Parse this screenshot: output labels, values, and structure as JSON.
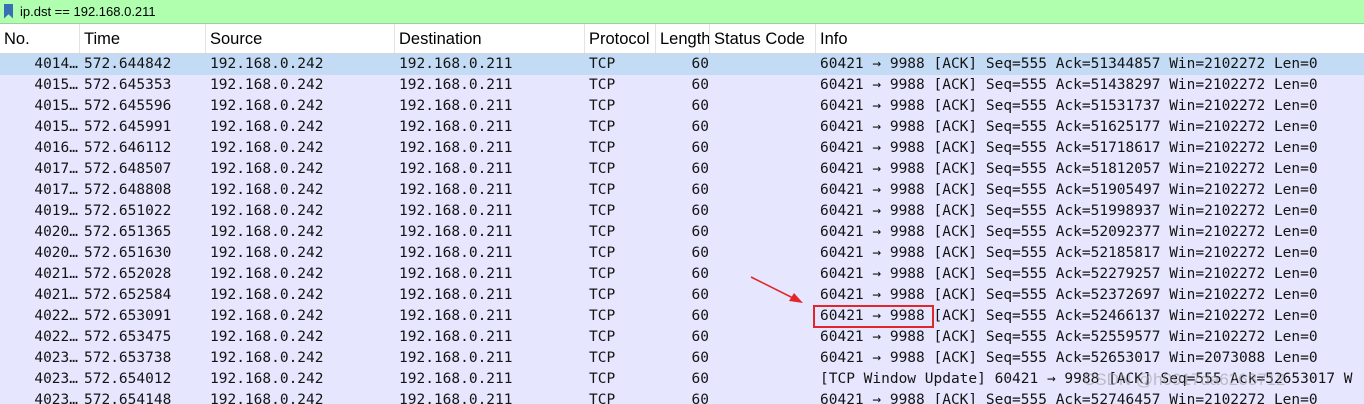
{
  "filter": {
    "value": "ip.dst == 192.168.0.211"
  },
  "columns": {
    "no": "No.",
    "time": "Time",
    "source": "Source",
    "destination": "Destination",
    "protocol": "Protocol",
    "length": "Length",
    "status": "Status Code",
    "info": "Info"
  },
  "packets": [
    {
      "no": "4014…",
      "time": "572.644842",
      "src": "192.168.0.242",
      "dst": "192.168.0.211",
      "proto": "TCP",
      "len": "60",
      "status": "",
      "info": "60421 → 9988 [ACK] Seq=555 Ack=51344857 Win=2102272 Len=0"
    },
    {
      "no": "4015…",
      "time": "572.645353",
      "src": "192.168.0.242",
      "dst": "192.168.0.211",
      "proto": "TCP",
      "len": "60",
      "status": "",
      "info": "60421 → 9988 [ACK] Seq=555 Ack=51438297 Win=2102272 Len=0"
    },
    {
      "no": "4015…",
      "time": "572.645596",
      "src": "192.168.0.242",
      "dst": "192.168.0.211",
      "proto": "TCP",
      "len": "60",
      "status": "",
      "info": "60421 → 9988 [ACK] Seq=555 Ack=51531737 Win=2102272 Len=0"
    },
    {
      "no": "4015…",
      "time": "572.645991",
      "src": "192.168.0.242",
      "dst": "192.168.0.211",
      "proto": "TCP",
      "len": "60",
      "status": "",
      "info": "60421 → 9988 [ACK] Seq=555 Ack=51625177 Win=2102272 Len=0"
    },
    {
      "no": "4016…",
      "time": "572.646112",
      "src": "192.168.0.242",
      "dst": "192.168.0.211",
      "proto": "TCP",
      "len": "60",
      "status": "",
      "info": "60421 → 9988 [ACK] Seq=555 Ack=51718617 Win=2102272 Len=0"
    },
    {
      "no": "4017…",
      "time": "572.648507",
      "src": "192.168.0.242",
      "dst": "192.168.0.211",
      "proto": "TCP",
      "len": "60",
      "status": "",
      "info": "60421 → 9988 [ACK] Seq=555 Ack=51812057 Win=2102272 Len=0"
    },
    {
      "no": "4017…",
      "time": "572.648808",
      "src": "192.168.0.242",
      "dst": "192.168.0.211",
      "proto": "TCP",
      "len": "60",
      "status": "",
      "info": "60421 → 9988 [ACK] Seq=555 Ack=51905497 Win=2102272 Len=0"
    },
    {
      "no": "4019…",
      "time": "572.651022",
      "src": "192.168.0.242",
      "dst": "192.168.0.211",
      "proto": "TCP",
      "len": "60",
      "status": "",
      "info": "60421 → 9988 [ACK] Seq=555 Ack=51998937 Win=2102272 Len=0"
    },
    {
      "no": "4020…",
      "time": "572.651365",
      "src": "192.168.0.242",
      "dst": "192.168.0.211",
      "proto": "TCP",
      "len": "60",
      "status": "",
      "info": "60421 → 9988 [ACK] Seq=555 Ack=52092377 Win=2102272 Len=0"
    },
    {
      "no": "4020…",
      "time": "572.651630",
      "src": "192.168.0.242",
      "dst": "192.168.0.211",
      "proto": "TCP",
      "len": "60",
      "status": "",
      "info": "60421 → 9988 [ACK] Seq=555 Ack=52185817 Win=2102272 Len=0"
    },
    {
      "no": "4021…",
      "time": "572.652028",
      "src": "192.168.0.242",
      "dst": "192.168.0.211",
      "proto": "TCP",
      "len": "60",
      "status": "",
      "info": "60421 → 9988 [ACK] Seq=555 Ack=52279257 Win=2102272 Len=0"
    },
    {
      "no": "4021…",
      "time": "572.652584",
      "src": "192.168.0.242",
      "dst": "192.168.0.211",
      "proto": "TCP",
      "len": "60",
      "status": "",
      "info": "60421 → 9988 [ACK] Seq=555 Ack=52372697 Win=2102272 Len=0"
    },
    {
      "no": "4022…",
      "time": "572.653091",
      "src": "192.168.0.242",
      "dst": "192.168.0.211",
      "proto": "TCP",
      "len": "60",
      "status": "",
      "info": "60421 → 9988 [ACK] Seq=555 Ack=52466137 Win=2102272 Len=0"
    },
    {
      "no": "4022…",
      "time": "572.653475",
      "src": "192.168.0.242",
      "dst": "192.168.0.211",
      "proto": "TCP",
      "len": "60",
      "status": "",
      "info": "60421 → 9988 [ACK] Seq=555 Ack=52559577 Win=2102272 Len=0"
    },
    {
      "no": "4023…",
      "time": "572.653738",
      "src": "192.168.0.242",
      "dst": "192.168.0.211",
      "proto": "TCP",
      "len": "60",
      "status": "",
      "info": "60421 → 9988 [ACK] Seq=555 Ack=52653017 Win=2073088 Len=0"
    },
    {
      "no": "4023…",
      "time": "572.654012",
      "src": "192.168.0.242",
      "dst": "192.168.0.211",
      "proto": "TCP",
      "len": "60",
      "status": "",
      "info": "[TCP Window Update] 60421 → 9988 [ACK] Seq=555 Ack=52653017 W"
    },
    {
      "no": "4023…",
      "time": "572.654148",
      "src": "192.168.0.242",
      "dst": "192.168.0.211",
      "proto": "TCP",
      "len": "60",
      "status": "",
      "info": "60421 → 9988 [ACK] Seq=555 Ack=52746457 Win=2102272 Len=0"
    }
  ],
  "selected_row": 0,
  "highlighted_row": 12,
  "colors": {
    "filter_bg": "#afffaf",
    "row_bg": "#e7e6ff",
    "selected_bg": "#c3dbf5",
    "annotation": "#e0282c"
  },
  "watermark": "CSDN @h0917da6263712"
}
